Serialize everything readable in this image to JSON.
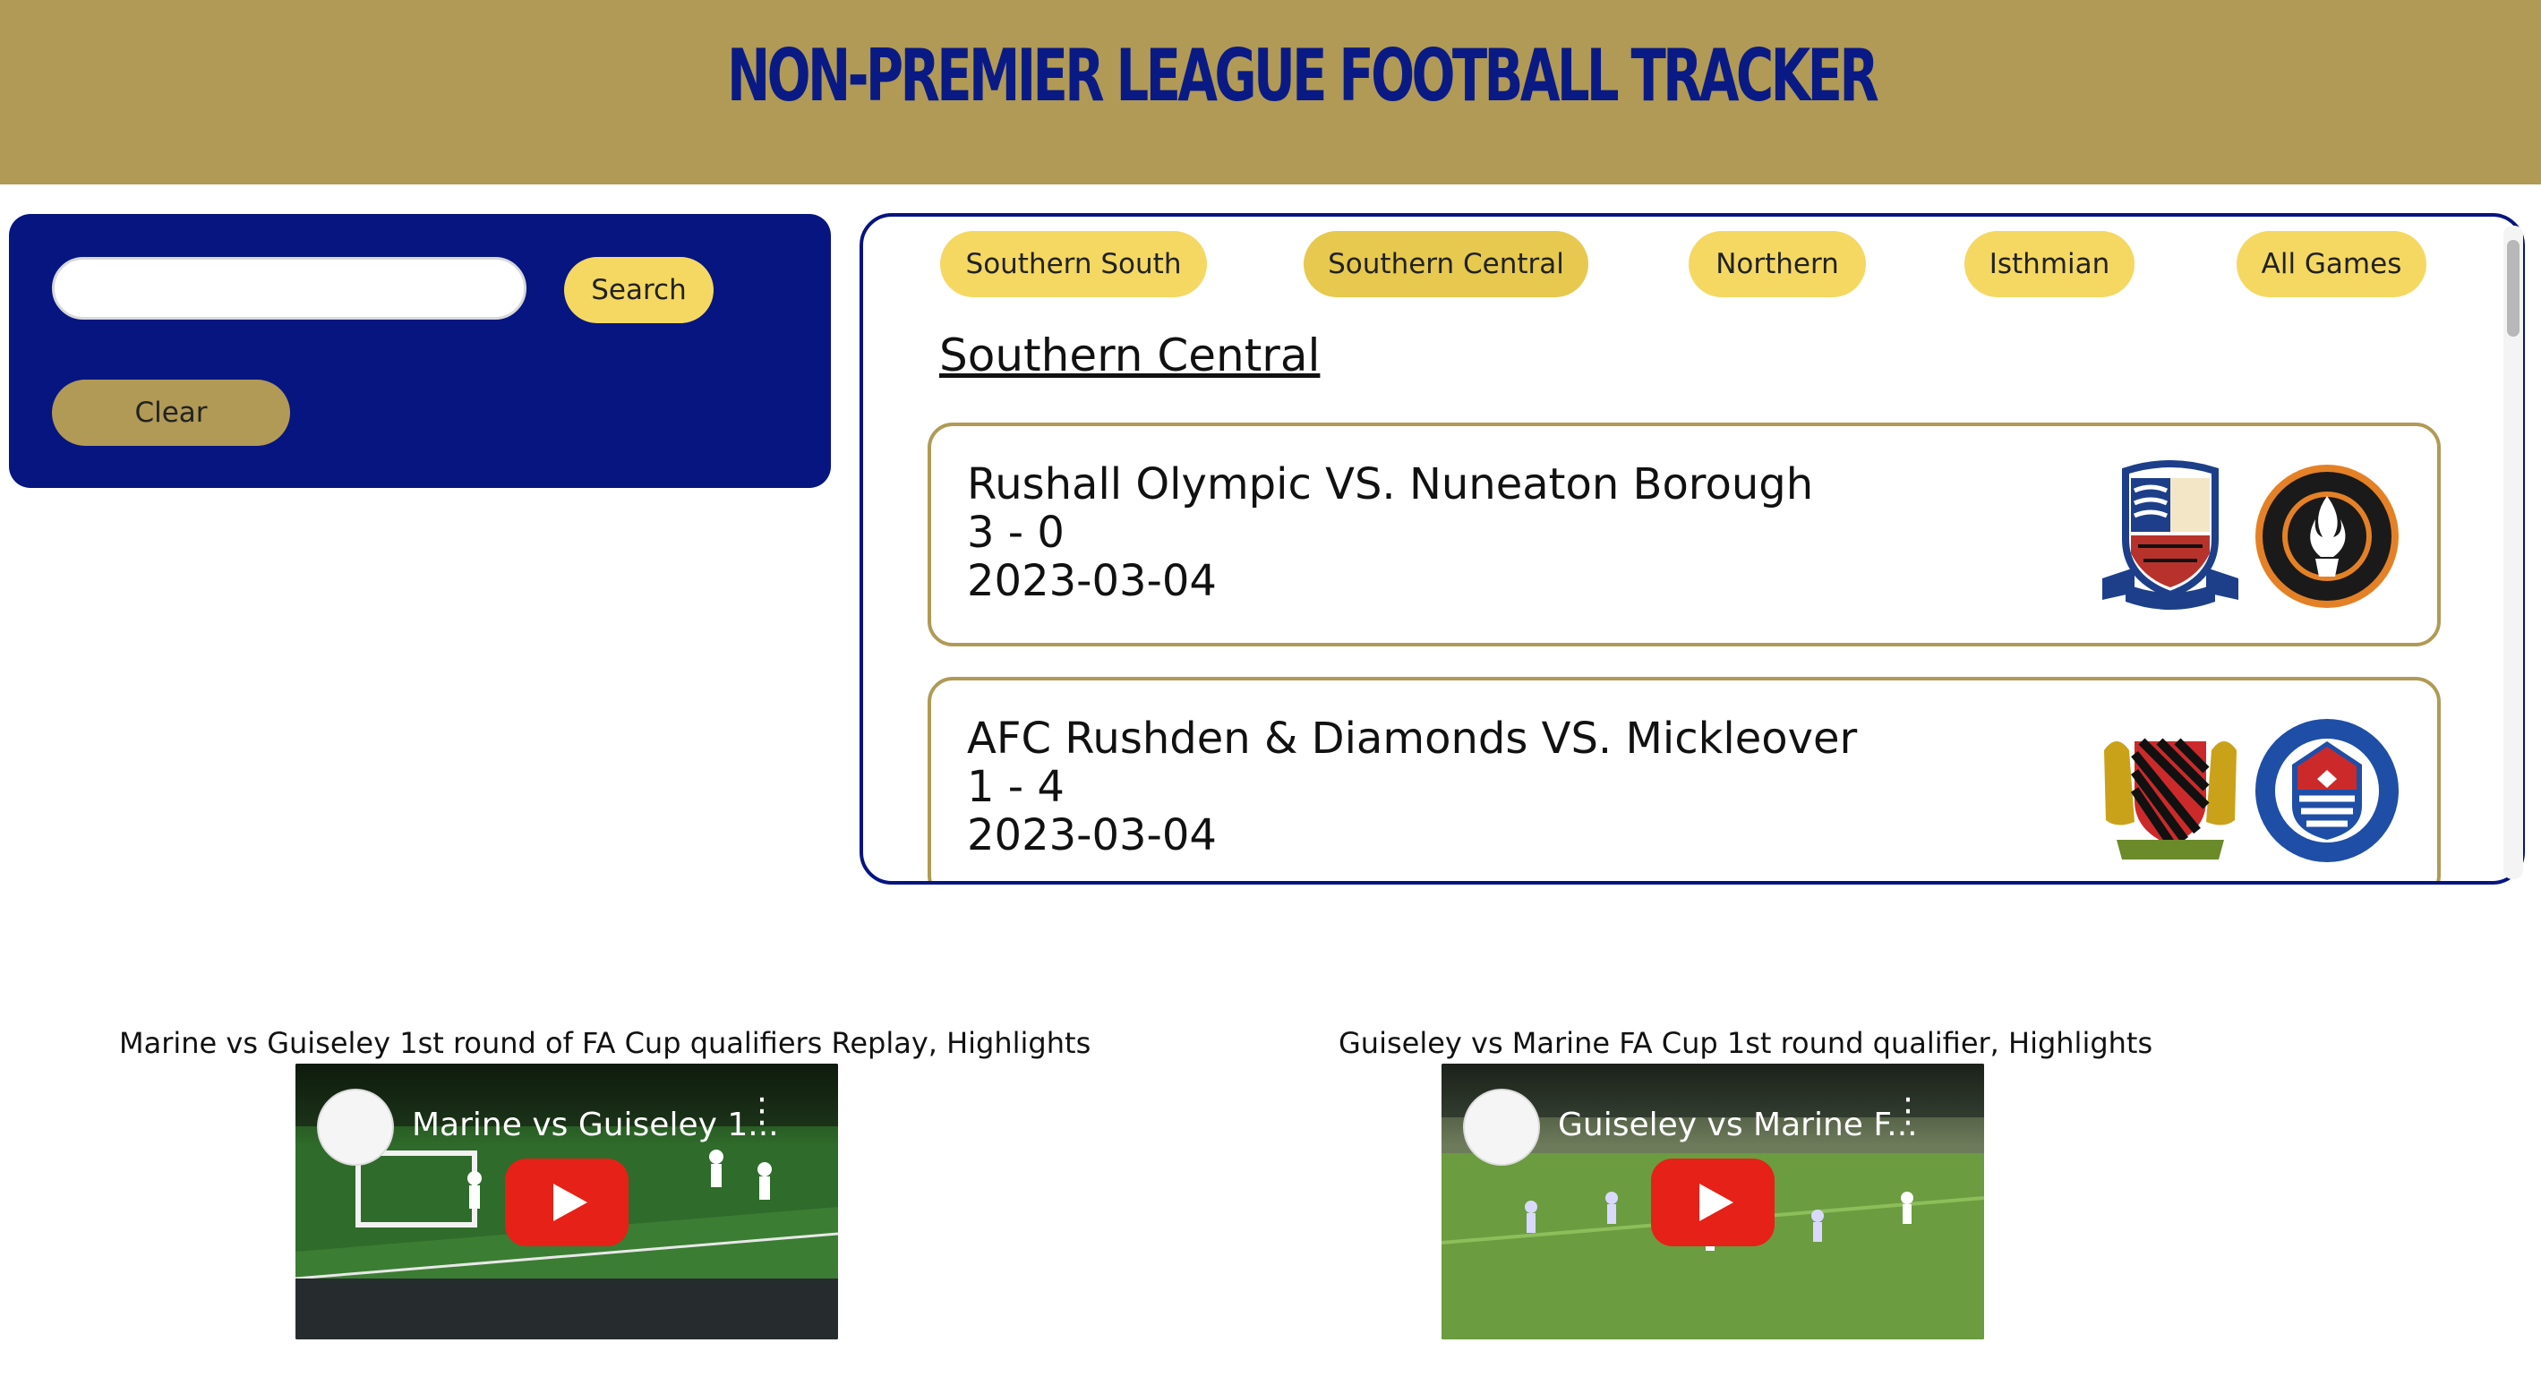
{
  "header": {
    "title": "NON-PREMIER LEAGUE FOOTBALL TRACKER"
  },
  "search": {
    "placeholder": "",
    "value": "",
    "search_label": "Search",
    "clear_label": "Clear"
  },
  "tabs": [
    {
      "label": "Southern South",
      "active": false
    },
    {
      "label": "Southern Central",
      "active": true
    },
    {
      "label": "Northern",
      "active": false
    },
    {
      "label": "Isthmian",
      "active": false
    },
    {
      "label": "All Games",
      "active": false
    }
  ],
  "section": {
    "title": "Southern Central"
  },
  "games": [
    {
      "teams": "Rushall Olympic VS. Nuneaton Borough",
      "score": "3 - 0",
      "date": "2023-03-04",
      "logos": [
        "nuneaton-borough-crest-icon",
        "rushall-olympic-crest-icon"
      ]
    },
    {
      "teams": "AFC Rushden & Diamonds VS. Mickleover",
      "score": "1 - 4",
      "date": "2023-03-04",
      "logos": [
        "mickleover-crest-icon",
        "afc-rushden-diamonds-crest-icon"
      ]
    }
  ],
  "videos": [
    {
      "title": "Marine vs Guiseley 1st round of FA Cup qualifiers Replay, Highlights",
      "overlay": "Marine vs Guiseley 1..."
    },
    {
      "title": "Guiseley vs Marine FA Cup 1st round qualifier, Highlights",
      "overlay": "Guiseley vs Marine F..."
    }
  ],
  "colors": {
    "gold": "#b09a55",
    "navy": "#061580",
    "yellow": "#f4d862",
    "play_red": "#e62117"
  }
}
